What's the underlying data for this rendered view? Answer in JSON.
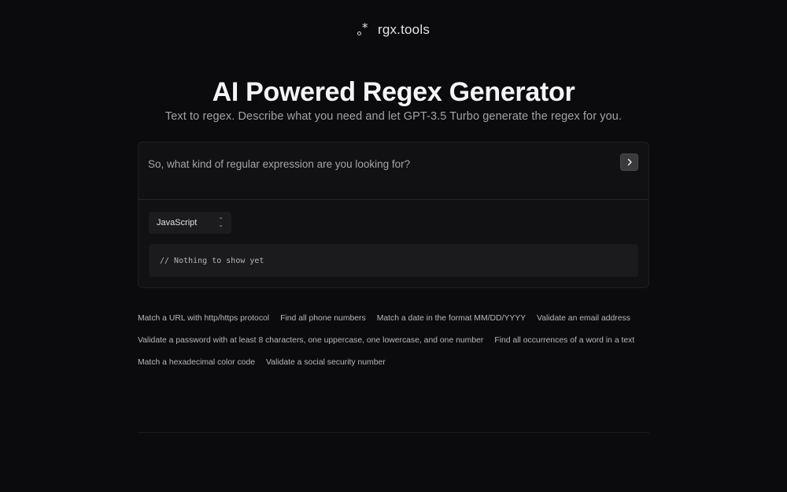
{
  "brand": {
    "name": "rgx.tools",
    "icon": "logo-dot-star-icon"
  },
  "hero": {
    "title": "AI Powered Regex Generator",
    "subtitle": "Text to regex. Describe what you need and let GPT-3.5 Turbo generate the regex for you."
  },
  "prompt": {
    "placeholder": "So, what kind of regular expression are you looking for?",
    "value": "",
    "submit_icon": "chevron-right-icon"
  },
  "language": {
    "selected": "JavaScript",
    "icon": "up-down-chevron-icon"
  },
  "output": {
    "text": "// Nothing to show yet"
  },
  "examples": [
    "Match a URL with http/https protocol",
    "Find all phone numbers",
    "Match a date in the format MM/DD/YYYY",
    "Validate an email address",
    "Validate a password with at least 8 characters, one uppercase, one lowercase, and one number",
    "Find all occurrences of a word in a text",
    "Match a hexadecimal color code",
    "Validate a social security number"
  ]
}
